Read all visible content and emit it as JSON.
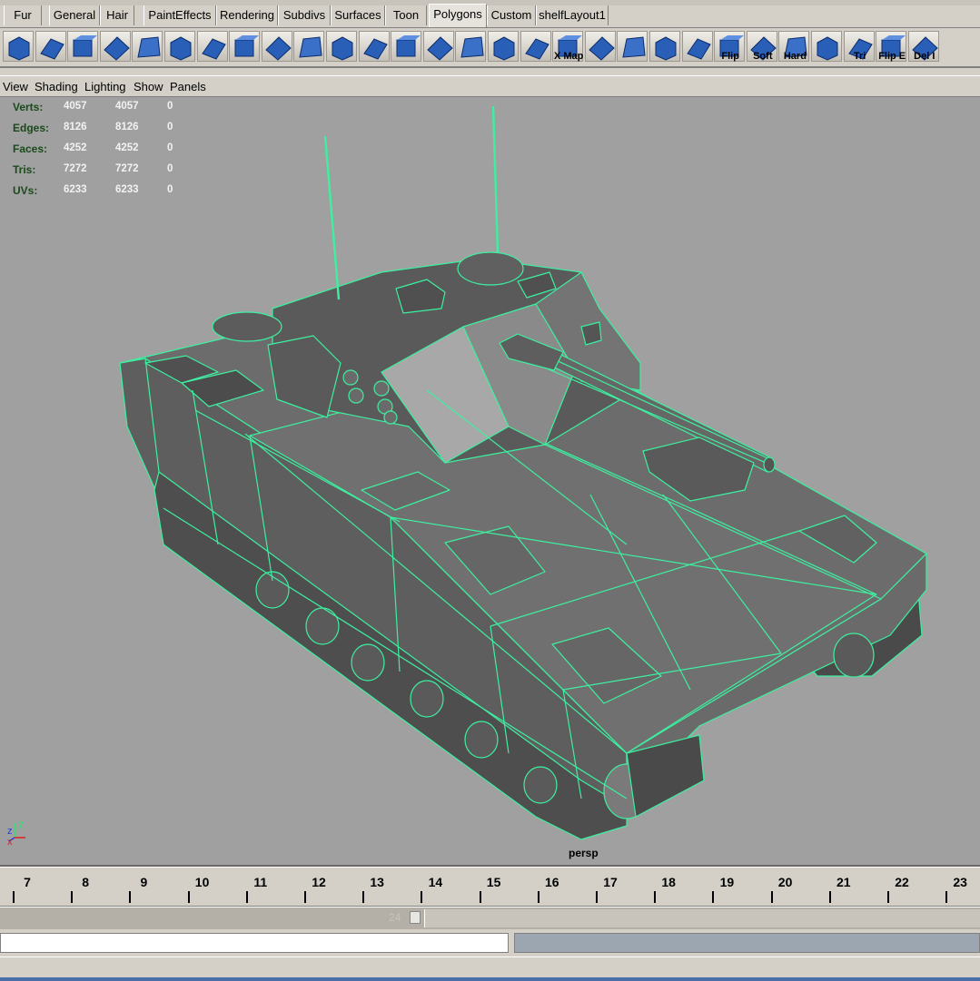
{
  "shelf_tabs": [
    "Fur",
    "General",
    "Hair",
    "PaintEffects",
    "Rendering",
    "Subdivs",
    "Surfaces",
    "Toon",
    "Polygons",
    "Custom",
    "shelfLayout1"
  ],
  "active_tab": "Polygons",
  "shelf_buttons": [
    {
      "icon": "poly-cube-arrow-icon",
      "label": ""
    },
    {
      "icon": "poly-cube-wire-icon",
      "label": ""
    },
    {
      "icon": "append-polygon-icon",
      "label": ""
    },
    {
      "icon": "split-polygon-icon",
      "label": ""
    },
    {
      "icon": "extrude-face-icon",
      "label": ""
    },
    {
      "icon": "extrude-edge-icon",
      "label": ""
    },
    {
      "icon": "bevel-icon",
      "label": ""
    },
    {
      "icon": "merge-vertices-icon",
      "label": ""
    },
    {
      "icon": "combine-icon",
      "label": ""
    },
    {
      "icon": "separate-icon",
      "label": ""
    },
    {
      "icon": "smooth-icon",
      "label": ""
    },
    {
      "icon": "triangulate-icon",
      "label": ""
    },
    {
      "icon": "quadrangulate-icon",
      "label": ""
    },
    {
      "icon": "delete-edge-icon",
      "label": ""
    },
    {
      "icon": "cut-faces-icon",
      "label": ""
    },
    {
      "icon": "planar-map-icon",
      "label": ""
    },
    {
      "icon": "uv-layout-icon",
      "label": ""
    },
    {
      "icon": "x-map-icon",
      "label": "X Map"
    },
    {
      "icon": "checker-uv-icon",
      "label": ""
    },
    {
      "icon": "sphere-map-icon",
      "label": ""
    },
    {
      "icon": "cylinder-map-icon",
      "label": ""
    },
    {
      "icon": "uv-editor-icon",
      "label": ""
    },
    {
      "icon": "flip-normals-icon",
      "label": "Flip"
    },
    {
      "icon": "soft-edge-icon",
      "label": "Soft"
    },
    {
      "icon": "hard-edge-icon",
      "label": "Hard"
    },
    {
      "icon": "poly-plane-icon",
      "label": ""
    },
    {
      "icon": "tri-icon",
      "label": "Tri"
    },
    {
      "icon": "flip-edge-icon",
      "label": "Flip E"
    },
    {
      "icon": "delete-icon",
      "label": "Del I"
    }
  ],
  "panel_menu": [
    "View",
    "Shading",
    "Lighting",
    "Show",
    "Panels"
  ],
  "hud": [
    {
      "label": "Verts:",
      "v1": "4057",
      "v2": "4057",
      "v3": "0"
    },
    {
      "label": "Edges:",
      "v1": "8126",
      "v2": "8126",
      "v3": "0"
    },
    {
      "label": "Faces:",
      "v1": "4252",
      "v2": "4252",
      "v3": "0"
    },
    {
      "label": "Tris:",
      "v1": "7272",
      "v2": "7272",
      "v3": "0"
    },
    {
      "label": "UVs:",
      "v1": "6233",
      "v2": "6233",
      "v3": "0"
    }
  ],
  "camera_label": "persp",
  "axis_labels": {
    "x": "x",
    "y": "y",
    "z": "z"
  },
  "timeline_numbers": [
    "7",
    "8",
    "9",
    "10",
    "11",
    "12",
    "13",
    "14",
    "15",
    "16",
    "17",
    "18",
    "19",
    "20",
    "21",
    "22",
    "23"
  ],
  "range_end": "24",
  "colors": {
    "viewport_bg": "#a0a0a0",
    "wireframe": "#3df0a0",
    "ui_bg": "#d4d0c8",
    "shelf_icon_blue": "#2a5fb8"
  }
}
